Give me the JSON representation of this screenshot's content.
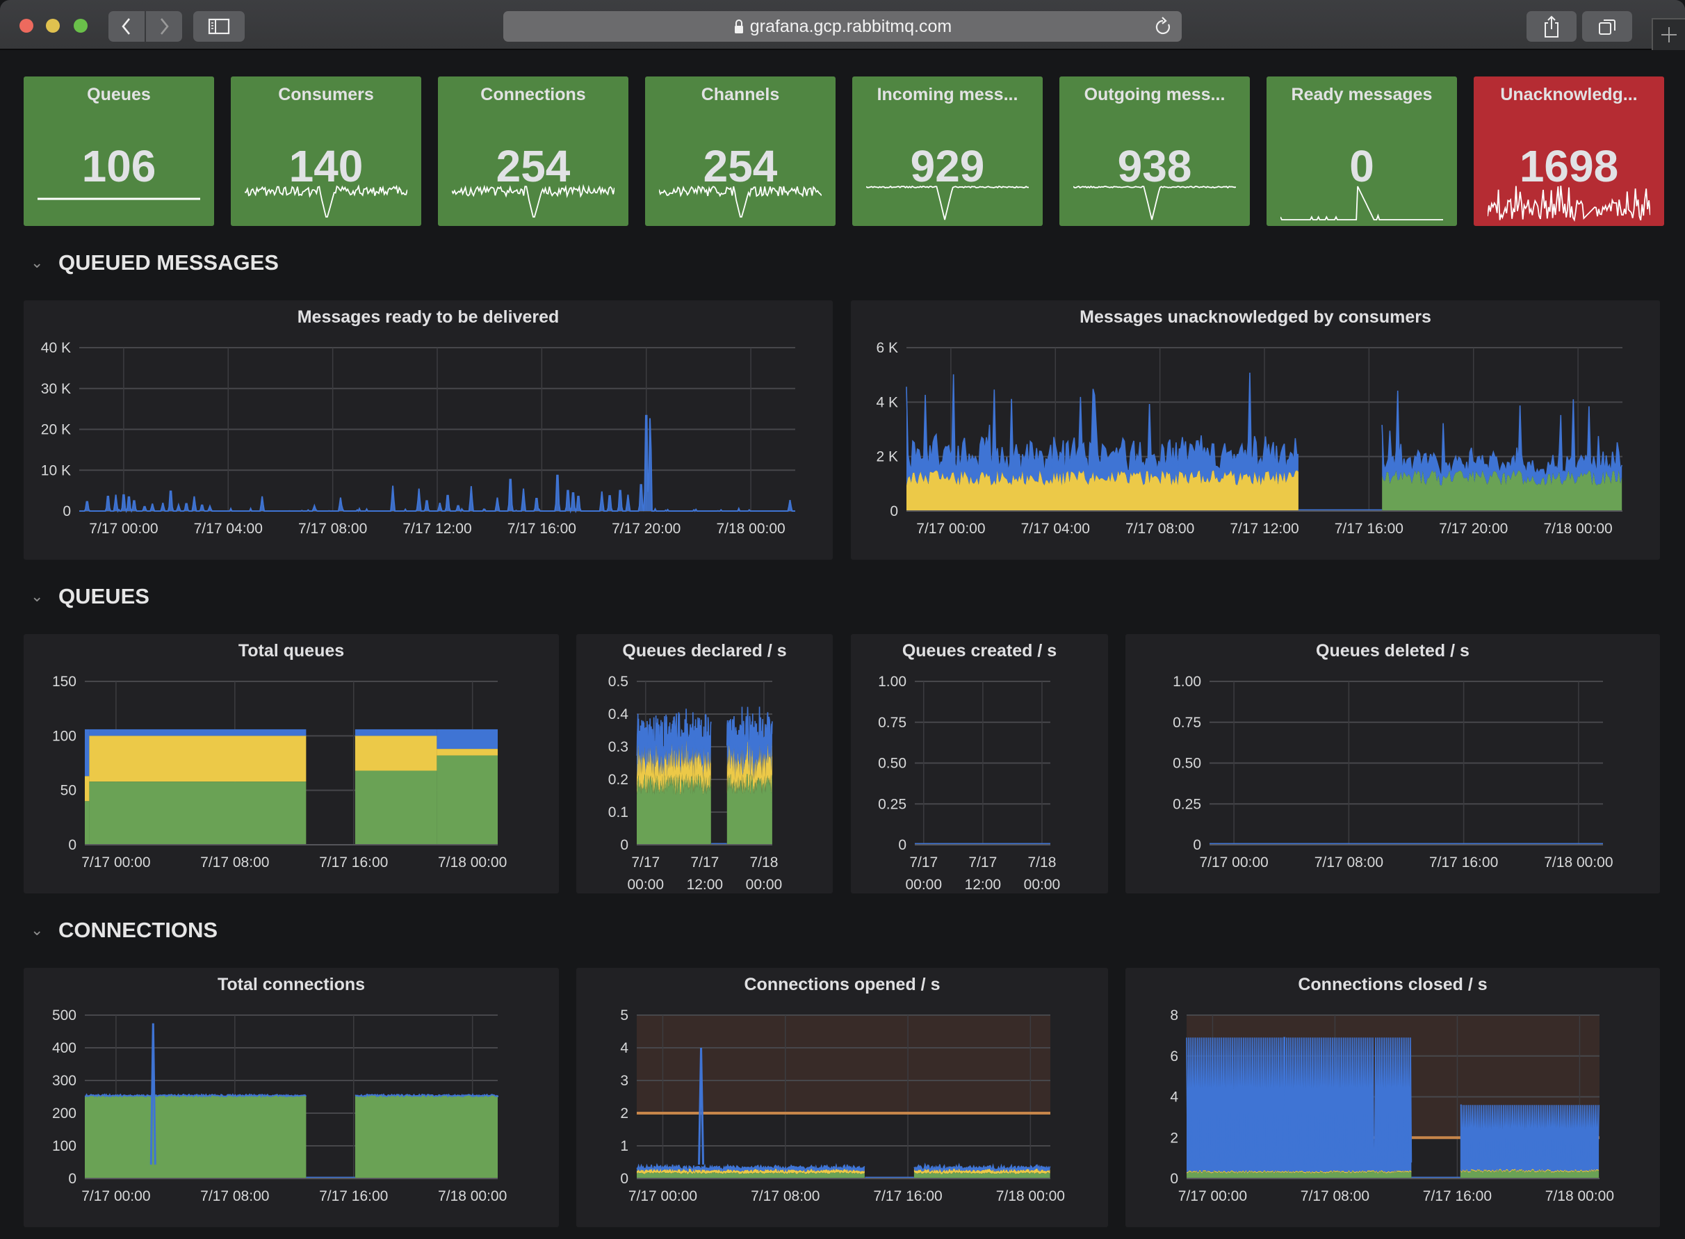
{
  "browser": {
    "url": "grafana.gcp.rabbitmq.com",
    "icons": [
      "close-window",
      "minimize-window",
      "maximize-window",
      "back-arrow",
      "forward-arrow",
      "sidebar-toggle",
      "lock",
      "reload",
      "share",
      "tabs-overview",
      "new-tab-plus"
    ]
  },
  "colors": {
    "stat_ok": "#508642",
    "stat_alert": "#b52c33",
    "series_blue": "#3f74d4",
    "series_yellow": "#ecc948",
    "series_green": "#6aa255",
    "threshold": "#c7864a",
    "threshold_fill": "#382b28"
  },
  "stats": [
    {
      "title": "Queues",
      "value": "106",
      "status": "ok",
      "spark": "flat"
    },
    {
      "title": "Consumers",
      "value": "140",
      "status": "ok",
      "spark": "noisy-dip"
    },
    {
      "title": "Connections",
      "value": "254",
      "status": "ok",
      "spark": "noisy-dip"
    },
    {
      "title": "Channels",
      "value": "254",
      "status": "ok",
      "spark": "noisy-dip"
    },
    {
      "title": "Incoming mess...",
      "value": "929",
      "status": "ok",
      "spark": "flat-dip"
    },
    {
      "title": "Outgoing mess...",
      "value": "938",
      "status": "ok",
      "spark": "flat-dip"
    },
    {
      "title": "Ready messages",
      "value": "0",
      "status": "ok",
      "spark": "spike"
    },
    {
      "title": "Unacknowledg...",
      "value": "1698",
      "status": "alert",
      "spark": "noisy"
    }
  ],
  "rows": [
    {
      "title": "QUEUED MESSAGES"
    },
    {
      "title": "QUEUES"
    },
    {
      "title": "CONNECTIONS"
    }
  ],
  "chart_data": [
    {
      "id": "ready",
      "title": "Messages ready to be delivered",
      "type": "area",
      "stacked": true,
      "x_ticks": [
        "7/17 00:00",
        "7/17 04:00",
        "7/17 08:00",
        "7/17 12:00",
        "7/17 16:00",
        "7/17 20:00",
        "7/18 00:00"
      ],
      "x_range_hours": [
        -1.7,
        25.7
      ],
      "y_ticks": [
        "0",
        "10 K",
        "20 K",
        "30 K",
        "40 K"
      ],
      "ylim": [
        0,
        40000
      ],
      "series": [
        {
          "name": "blue",
          "color": "#3f74d4",
          "spikes": [
            [
              -1.4,
              3200
            ],
            [
              -0.6,
              5000
            ],
            [
              -0.3,
              4000
            ],
            [
              0,
              5500
            ],
            [
              0.2,
              4800
            ],
            [
              0.4,
              3500
            ],
            [
              0.8,
              1500
            ],
            [
              1.1,
              1800
            ],
            [
              1.5,
              2000
            ],
            [
              1.8,
              6800
            ],
            [
              2.1,
              1500
            ],
            [
              2.4,
              2500
            ],
            [
              2.7,
              3600
            ],
            [
              3.0,
              2000
            ],
            [
              3.3,
              1200
            ],
            [
              5.3,
              3600
            ],
            [
              7.3,
              1300
            ],
            [
              8.3,
              3300
            ],
            [
              10.3,
              6200
            ],
            [
              11.3,
              5500
            ],
            [
              11.6,
              3500
            ],
            [
              12.1,
              2000
            ],
            [
              12.4,
              5300
            ],
            [
              12.8,
              1800
            ],
            [
              13.3,
              6100
            ],
            [
              14.3,
              3300
            ],
            [
              14.8,
              10800
            ],
            [
              15.3,
              5500
            ],
            [
              15.8,
              4300
            ],
            [
              16.6,
              12200
            ],
            [
              17.0,
              7000
            ],
            [
              17.2,
              6200
            ],
            [
              17.4,
              5000
            ],
            [
              18.3,
              4800
            ],
            [
              18.6,
              5200
            ],
            [
              19.0,
              7000
            ],
            [
              19.3,
              4000
            ],
            [
              19.8,
              9000
            ],
            [
              20.0,
              32700
            ],
            [
              20.15,
              26500
            ],
            [
              25.5,
              2700
            ]
          ],
          "note": "spike x values in hours from 7/17 00:00 (approx)"
        },
        {
          "name": "yellow",
          "color": "#ecc948"
        },
        {
          "name": "green",
          "color": "#6aa255"
        }
      ]
    },
    {
      "id": "unacked",
      "title": "Messages unacknowledged by consumers",
      "type": "area",
      "stacked": true,
      "x_ticks": [
        "7/17 00:00",
        "7/17 04:00",
        "7/17 08:00",
        "7/17 12:00",
        "7/17 16:00",
        "7/17 20:00",
        "7/18 00:00"
      ],
      "x_range_hours": [
        -1.7,
        25.7
      ],
      "y_ticks": [
        "0",
        "2 K",
        "4 K",
        "6 K"
      ],
      "ylim": [
        0,
        6000
      ],
      "segments": [
        {
          "from_hour": -1.7,
          "to_hour": 13.3,
          "base_series": "yellow",
          "base_mean": 1250,
          "top_series": "blue",
          "top_mean": 2200,
          "top_peak": 5150
        },
        {
          "from_hour": 13.3,
          "to_hour": 16.5,
          "value": 0
        },
        {
          "from_hour": 16.5,
          "to_hour": 25.7,
          "base_series": "green",
          "base_mean": 1250,
          "top_series": "blue",
          "top_mean": 1800,
          "top_peak": 4700
        }
      ]
    },
    {
      "id": "total-queues",
      "title": "Total queues",
      "type": "area",
      "stacked": true,
      "x_ticks": [
        "7/17 00:00",
        "7/17 08:00",
        "7/17 16:00",
        "7/18 00:00"
      ],
      "x_range_hours": [
        -2.1,
        25.7
      ],
      "y_ticks": [
        "0",
        "50",
        "100",
        "150"
      ],
      "ylim": [
        0,
        150
      ],
      "segments": [
        {
          "from_hour": -2.1,
          "to_hour": -1.8,
          "green": 40,
          "yellow": 23,
          "blue": 43
        },
        {
          "from_hour": -1.8,
          "to_hour": 12.8,
          "green": 58,
          "yellow": 42,
          "blue": 6
        },
        {
          "from_hour": 12.8,
          "to_hour": 16.1,
          "green": 0,
          "yellow": 0,
          "blue": 0
        },
        {
          "from_hour": 16.1,
          "to_hour": 21.6,
          "green": 68,
          "yellow": 32,
          "blue": 6
        },
        {
          "from_hour": 21.6,
          "to_hour": 25.7,
          "green": 82,
          "yellow": 6,
          "blue": 18
        }
      ]
    },
    {
      "id": "queues-declared",
      "title": "Queues declared / s",
      "type": "area",
      "stacked": true,
      "x_ticks": [
        "7/17\n00:00",
        "7/17\n12:00",
        "7/18\n00:00"
      ],
      "x_range_hours": [
        -1.8,
        25.7
      ],
      "y_ticks": [
        "0",
        "0.1",
        "0.2",
        "0.3",
        "0.4",
        "0.5"
      ],
      "ylim": [
        0,
        0.5
      ],
      "segments": [
        {
          "from_hour": -1.8,
          "to_hour": 13.3,
          "green_mean": 0.19,
          "yellow_mean": 0.07,
          "blue_mean": 0.07
        },
        {
          "from_hour": 13.3,
          "to_hour": 16.5,
          "value": 0
        },
        {
          "from_hour": 16.5,
          "to_hour": 25.7,
          "green_mean": 0.19,
          "yellow_mean": 0.07,
          "blue_mean": 0.07
        }
      ]
    },
    {
      "id": "queues-created",
      "title": "Queues created / s",
      "type": "line",
      "x_ticks": [
        "7/17\n00:00",
        "7/17\n12:00",
        "7/18\n00:00"
      ],
      "x_range_hours": [
        -1.8,
        25.7
      ],
      "y_ticks": [
        "0",
        "0.25",
        "0.50",
        "0.75",
        "1.00"
      ],
      "ylim": [
        0,
        1
      ],
      "constant_value": 0
    },
    {
      "id": "queues-deleted",
      "title": "Queues deleted / s",
      "type": "line",
      "x_ticks": [
        "7/17 00:00",
        "7/17 08:00",
        "7/17 16:00",
        "7/18 00:00"
      ],
      "x_range_hours": [
        -1.7,
        25.7
      ],
      "y_ticks": [
        "0",
        "0.25",
        "0.50",
        "0.75",
        "1.00"
      ],
      "ylim": [
        0,
        1
      ],
      "constant_value": 0
    },
    {
      "id": "total-connections",
      "title": "Total connections",
      "type": "area",
      "x_ticks": [
        "7/17 00:00",
        "7/17 08:00",
        "7/17 16:00",
        "7/18 00:00"
      ],
      "x_range_hours": [
        -2.1,
        25.7
      ],
      "y_ticks": [
        "0",
        "100",
        "200",
        "300",
        "400",
        "500"
      ],
      "ylim": [
        0,
        500
      ],
      "segments": [
        {
          "from_hour": -2.1,
          "to_hour": 12.8,
          "value": 254
        },
        {
          "from_hour": 12.8,
          "to_hour": 16.1,
          "value": 0
        },
        {
          "from_hour": 16.1,
          "to_hour": 25.7,
          "value": 254
        }
      ],
      "spike": {
        "hour": 2.5,
        "value": 475
      }
    },
    {
      "id": "connections-opened",
      "title": "Connections opened / s",
      "type": "area",
      "stacked": true,
      "x_ticks": [
        "7/17 00:00",
        "7/17 08:00",
        "7/17 16:00",
        "7/18 00:00"
      ],
      "x_range_hours": [
        -1.7,
        25.3
      ],
      "y_ticks": [
        "0",
        "1",
        "2",
        "3",
        "4",
        "5"
      ],
      "ylim": [
        0,
        5
      ],
      "threshold": 2,
      "segments": [
        {
          "from_hour": -1.7,
          "to_hour": 13.2,
          "green_mean": 0.17,
          "yellow_mean": 0.08,
          "blue_mean": 0.08
        },
        {
          "from_hour": 13.2,
          "to_hour": 16.4,
          "value": 0
        },
        {
          "from_hour": 16.4,
          "to_hour": 25.3,
          "green_mean": 0.17,
          "yellow_mean": 0.08,
          "blue_mean": 0.08
        }
      ],
      "spike": {
        "hour": 2.5,
        "value": 4
      }
    },
    {
      "id": "connections-closed",
      "title": "Connections closed / s",
      "type": "area",
      "stacked": true,
      "x_ticks": [
        "7/17 00:00",
        "7/17 08:00",
        "7/17 16:00",
        "7/18 00:00"
      ],
      "x_range_hours": [
        -1.7,
        25.3
      ],
      "y_ticks": [
        "0",
        "2",
        "4",
        "6",
        "8"
      ],
      "ylim": [
        0,
        8
      ],
      "threshold": 2,
      "segments": [
        {
          "from_hour": -1.7,
          "to_hour": 13.0,
          "green_mean": 0.3,
          "yellow_mean": 0.05,
          "blue_peak": 6.9
        },
        {
          "from_hour": 13.0,
          "to_hour": 16.2,
          "value": 0
        },
        {
          "from_hour": 16.2,
          "to_hour": 25.3,
          "green_mean": 0.35,
          "yellow_mean": 0.05,
          "blue_peak": 3.6
        }
      ]
    }
  ]
}
